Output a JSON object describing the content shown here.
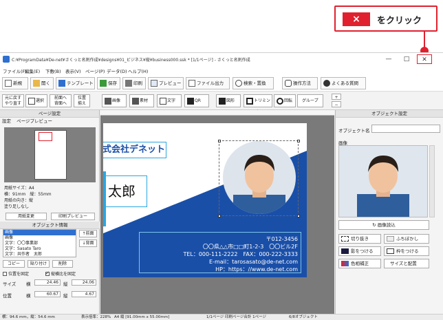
{
  "callout": {
    "x_label": "×",
    "text": "をクリック"
  },
  "window": {
    "title": "C:¥ProgramData¥De-net¥さくっと名刺作成¥designs¥01_ビジネス¥縦¥business000.ssk * [1/1ページ] - さくっと名刺作成",
    "minimize": "—",
    "maximize": "□",
    "close": "✕"
  },
  "menu": [
    "ファイル(F)",
    "編集(E)",
    "下敷(B)",
    "表示(V)",
    "ページ(P)",
    "データ(D)",
    "ヘルプ(H)"
  ],
  "toolbar": {
    "new": "新規",
    "open": "開く",
    "template": "テンプレート",
    "save": "保存",
    "print": "印刷",
    "preview": "プレビュー",
    "file_out": "ファイル出力",
    "search": "検索・置換",
    "howto": "操作方法",
    "faq": "よくある質問"
  },
  "toolbar2": {
    "undo_1": "元に戻す",
    "undo_2": "やり直す",
    "select": "選択",
    "order_1": "前面へ",
    "order_2": "背面へ",
    "align_1": "位置",
    "align_2": "揃え",
    "image": "画像",
    "material": "素材",
    "text": "文字",
    "qr": "QR",
    "shape": "図形",
    "trim": "トリミング",
    "rotate": "回転",
    "group": "グループ",
    "zoom_in": "+",
    "zoom_out": "−"
  },
  "left_panel": {
    "title": "ページ設定",
    "tab_settings": "設定",
    "tab_preview": "ページプレビュー",
    "paper_size": "用紙サイズ：A4",
    "dims": "横：91mm　縦：55mm",
    "orientation": "用紙の向き：縦",
    "bleed": "塗り足しなし",
    "change_paper": "用紙変更",
    "print_preview": "印刷プレビュー",
    "object_title": "オブジェクト情報",
    "objects": [
      "画像",
      "画像",
      "文字：〇〇事業部",
      "文字：Sasato Taro",
      "文字：共作者　太郎"
    ],
    "front": "↑前面",
    "back": "↓背面",
    "copy": "コピー",
    "paste": "貼り付け",
    "delete": "削除",
    "fix_position": "位置を固定",
    "keep_ratio": "縦横比を固定",
    "size_label": "サイズ",
    "pos_label": "位置",
    "w_label": "横",
    "h_label": "縦",
    "size_w": "24.46",
    "size_h": "24.06",
    "pos_x": "60.67",
    "pos_y": "4.67"
  },
  "card": {
    "company": "式会社デネット",
    "name": "太郎",
    "zip": "〒012-3456",
    "address": "〇〇県△△市□□町1-2-3　〇〇ビル2F",
    "tel": "TEL：000-111-2222　FAX：000-222-3333",
    "email": "E-mail：tarosasato@de-net.com",
    "hp": "HP：https：//www.de-net.com"
  },
  "right_panel": {
    "title": "オブジェクト設定",
    "name_label": "オブジェクト名",
    "image_label": "画像",
    "load_image": "画像読込",
    "cutout": "切り抜き",
    "blur": "ふちぼかし",
    "shadow": "影をつける",
    "frame": "枠をつける",
    "color": "色相補正",
    "size_pos": "サイズと配置"
  },
  "status": {
    "dims": "横：94.6 mm，縦：54.6 mm",
    "zoom": "表示倍率：228%",
    "paper": "A4 縦 [91.00mm x 55.00mm]",
    "page": "1/1ページ 印刷ページ合計 1ページ",
    "objects": "6/8オブジェクト"
  },
  "colors": {
    "accent": "#e0202e",
    "card_blue": "#1a4fa8",
    "select_blue": "#2f6fd0"
  }
}
